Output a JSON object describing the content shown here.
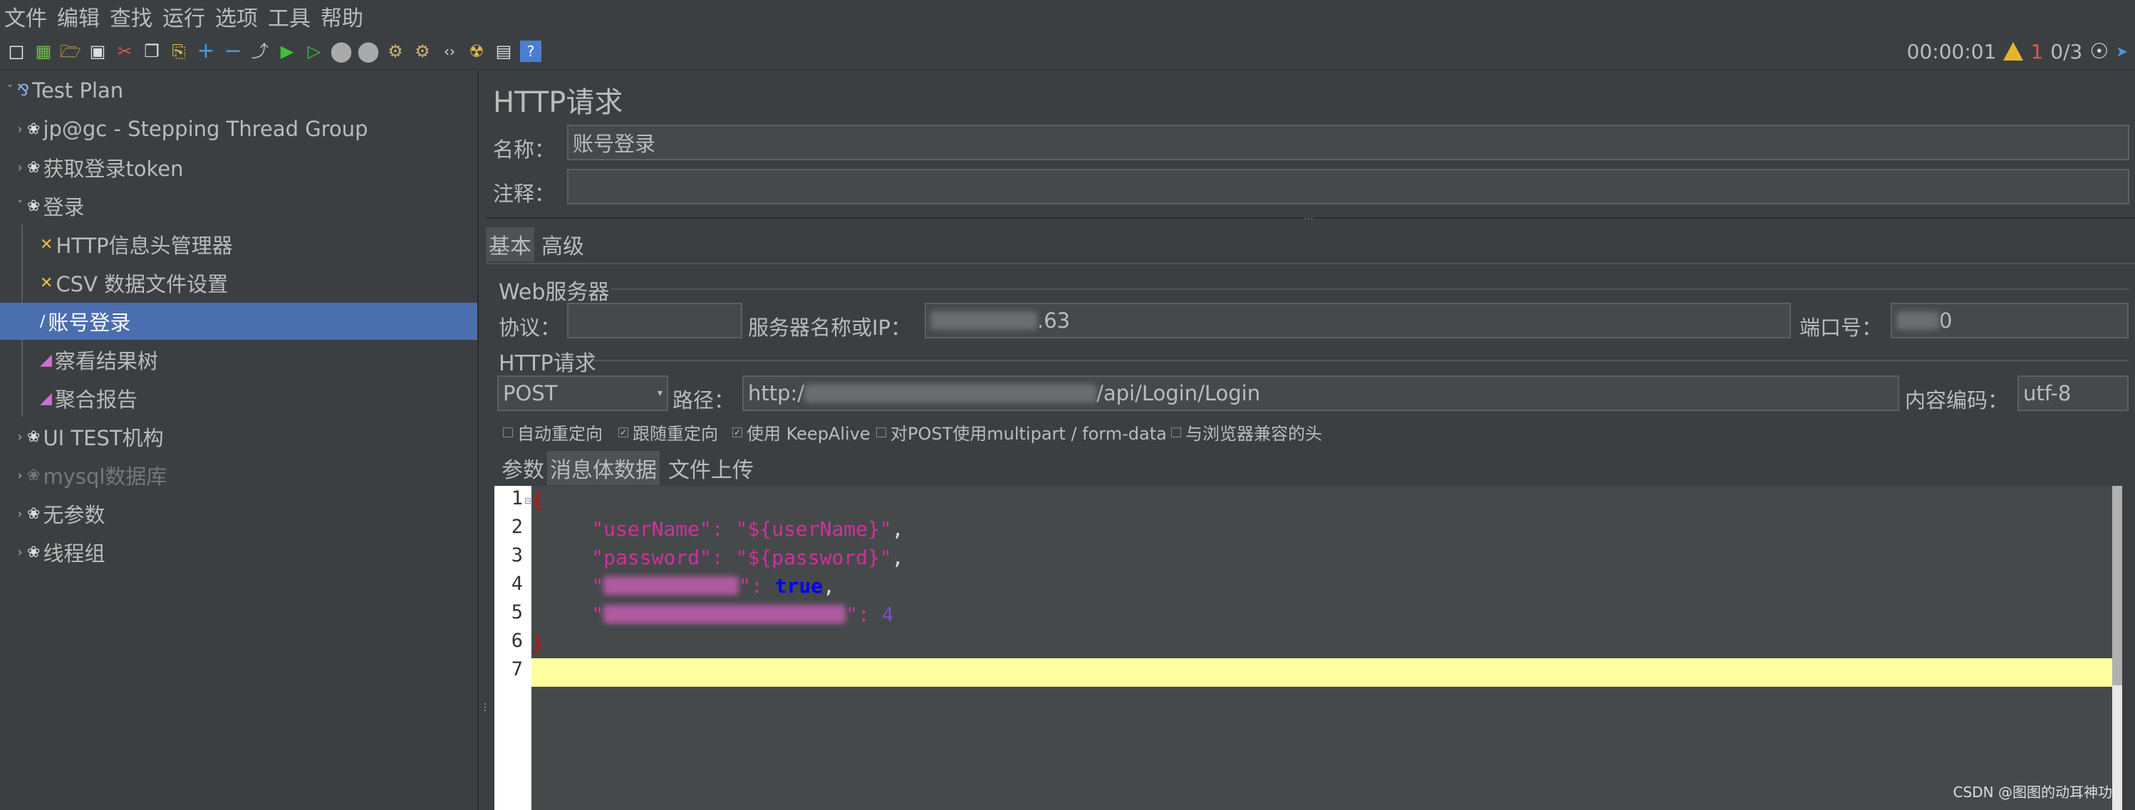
{
  "menu": [
    "文件",
    "编辑",
    "查找",
    "运行",
    "选项",
    "工具",
    "帮助"
  ],
  "toolbar": {
    "timer": "00:00:01",
    "error_count": "1",
    "threads": "0/3"
  },
  "tree": {
    "root": "Test Plan",
    "items": [
      {
        "label": "jp@gc - Stepping Thread Group",
        "type": "thread-group"
      },
      {
        "label": "获取登录token",
        "type": "thread-group"
      },
      {
        "label": "登录",
        "type": "thread-group",
        "expanded": true
      },
      {
        "label": "HTTP信息头管理器",
        "type": "config",
        "child": true
      },
      {
        "label": "CSV 数据文件设置",
        "type": "config",
        "child": true
      },
      {
        "label": "账号登录",
        "type": "sampler",
        "child": true,
        "selected": true
      },
      {
        "label": "察看结果树",
        "type": "listener",
        "child": true
      },
      {
        "label": "聚合报告",
        "type": "listener",
        "child": true
      },
      {
        "label": "UI TEST机构",
        "type": "thread-group"
      },
      {
        "label": "mysql数据库",
        "type": "thread-group",
        "disabled": true
      },
      {
        "label": "无参数",
        "type": "thread-group"
      },
      {
        "label": "线程组",
        "type": "thread-group"
      }
    ]
  },
  "panel": {
    "title": "HTTP请求",
    "name_label": "名称：",
    "name_value": "账号登录",
    "comment_label": "注释：",
    "comment_value": "",
    "tabs": [
      "基本",
      "高级"
    ],
    "web_server": {
      "section": "Web服务器",
      "protocol_label": "协议：",
      "protocol_value": "",
      "server_label": "服务器名称或IP：",
      "server_value_visible": ".63",
      "port_label": "端口号：",
      "port_value_visible": "0"
    },
    "http_request": {
      "section": "HTTP请求",
      "method": "POST",
      "path_label": "路径：",
      "path_prefix": "http:/",
      "path_suffix": "/api/Login/Login",
      "encoding_label": "内容编码：",
      "encoding_value": "utf-8"
    },
    "checkboxes": [
      {
        "label": "自动重定向",
        "checked": false
      },
      {
        "label": "跟随重定向",
        "checked": true
      },
      {
        "label": "使用 KeepAlive",
        "checked": true
      },
      {
        "label": "对POST使用multipart / form-data",
        "checked": false
      },
      {
        "label": "与浏览器兼容的头",
        "checked": false
      }
    ],
    "body_tabs": [
      "参数",
      "消息体数据",
      "文件上传"
    ],
    "body_lines": [
      {
        "n": "1",
        "brace": "{"
      },
      {
        "n": "2",
        "key": "\"userName\"",
        "colon": ": ",
        "val": "\"${userName}\"",
        "tail": ","
      },
      {
        "n": "3",
        "key": "\"password\"",
        "colon": ": ",
        "val": "\"${password}\"",
        "tail": ","
      },
      {
        "n": "4",
        "key_blur": true,
        "colon": ": ",
        "kw": "true",
        "tail": ","
      },
      {
        "n": "5",
        "key_blur": true,
        "colon": ": ",
        "num": "4"
      },
      {
        "n": "6",
        "brace": "}"
      },
      {
        "n": "7"
      }
    ]
  },
  "watermark": "CSDN @图图的动耳神功"
}
